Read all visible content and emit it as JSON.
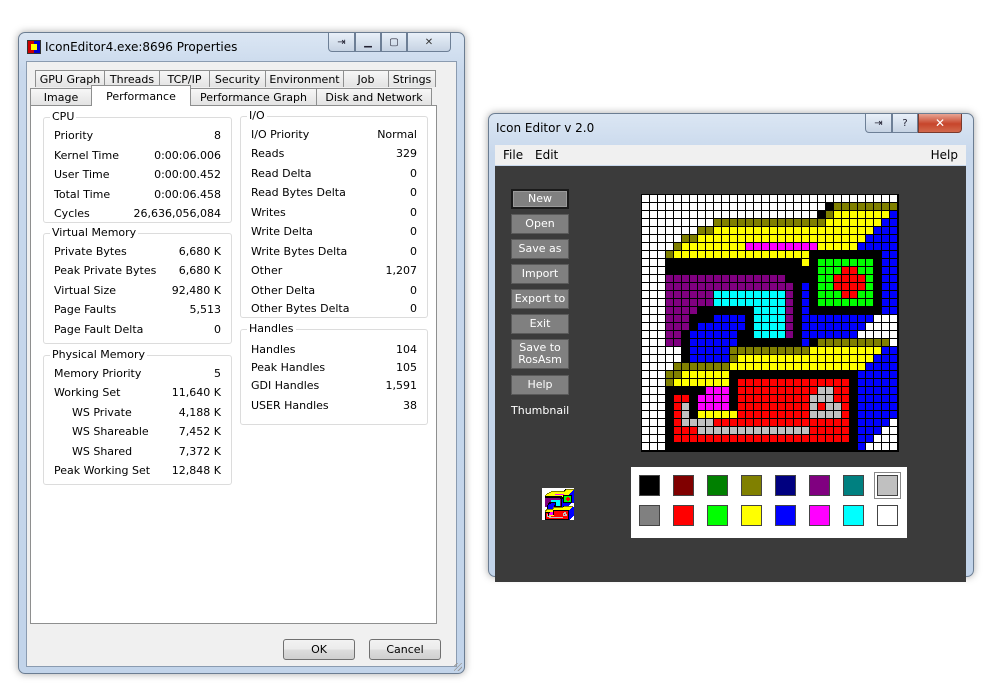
{
  "props_window": {
    "title": "IconEditor4.exe:8696 Properties",
    "tabs_row1": [
      "GPU Graph",
      "Threads",
      "TCP/IP",
      "Security",
      "Environment",
      "Job",
      "Strings"
    ],
    "tabs_row2": [
      "Image",
      "Performance",
      "Performance Graph",
      "Disk and Network"
    ],
    "selected_tab": "Performance",
    "cpu": {
      "label": "CPU",
      "rows": [
        {
          "k": "Priority",
          "v": "8"
        },
        {
          "k": "Kernel Time",
          "v": "0:00:06.006"
        },
        {
          "k": "User Time",
          "v": "0:00:00.452"
        },
        {
          "k": "Total Time",
          "v": "0:00:06.458"
        },
        {
          "k": "Cycles",
          "v": "26,636,056,084"
        }
      ]
    },
    "virtual_memory": {
      "label": "Virtual Memory",
      "rows": [
        {
          "k": "Private Bytes",
          "v": "6,680 K"
        },
        {
          "k": "Peak Private Bytes",
          "v": "6,680 K"
        },
        {
          "k": "Virtual Size",
          "v": "92,480 K"
        },
        {
          "k": "Page Faults",
          "v": "5,513"
        },
        {
          "k": "Page Fault Delta",
          "v": "0"
        }
      ]
    },
    "physical_memory": {
      "label": "Physical Memory",
      "rows": [
        {
          "k": "Memory Priority",
          "v": "5"
        },
        {
          "k": "Working Set",
          "v": "11,640 K"
        },
        {
          "k": "WS Private",
          "v": "4,188 K"
        },
        {
          "k": "WS Shareable",
          "v": "7,452 K"
        },
        {
          "k": "WS Shared",
          "v": "7,372 K"
        },
        {
          "k": "Peak Working Set",
          "v": "12,848 K"
        }
      ]
    },
    "io": {
      "label": "I/O",
      "rows": [
        {
          "k": "I/O Priority",
          "v": "Normal"
        },
        {
          "k": "Reads",
          "v": "329"
        },
        {
          "k": "Read Delta",
          "v": "0"
        },
        {
          "k": "Read Bytes Delta",
          "v": "0"
        },
        {
          "k": "Writes",
          "v": "0"
        },
        {
          "k": "Write Delta",
          "v": "0"
        },
        {
          "k": "Write Bytes Delta",
          "v": "0"
        },
        {
          "k": "Other",
          "v": "1,207"
        },
        {
          "k": "Other Delta",
          "v": "0"
        },
        {
          "k": "Other Bytes Delta",
          "v": "0"
        }
      ]
    },
    "handles": {
      "label": "Handles",
      "rows": [
        {
          "k": "Handles",
          "v": "104"
        },
        {
          "k": "Peak Handles",
          "v": "105"
        },
        {
          "k": "GDI Handles",
          "v": "1,591"
        },
        {
          "k": "USER Handles",
          "v": "38"
        }
      ]
    },
    "ok_label": "OK",
    "cancel_label": "Cancel"
  },
  "icon_editor": {
    "title": "Icon Editor v 2.0",
    "menu": {
      "file": "File",
      "edit": "Edit",
      "help": "Help"
    },
    "buttons": [
      "New",
      "Open",
      "Save as",
      "Import",
      "Export to",
      "Exit",
      "Save to RosAsm",
      "Help"
    ],
    "thumbnail_label": "Thumbnail",
    "palette_row1": [
      "#000000",
      "#800000",
      "#008000",
      "#808000",
      "#000080",
      "#800080",
      "#008080",
      "#c0c0c0"
    ],
    "palette_row2": [
      "#808080",
      "#ff0000",
      "#00ff00",
      "#ffff00",
      "#0000ff",
      "#ff00ff",
      "#00ffff",
      "#ffffff"
    ],
    "selected_color": "#c0c0c0",
    "pixel_map": [
      "WWWWWWWWWWWWWWWWWWWWWWWWWWWWWWWW",
      "WWWWWWWWWWWWWWWWWWWWWWWKOOOOOOOO",
      "WWWWWWWWWWWWWWWWWWWWWWKOYYYYYYYB",
      "WWWWWWWWWOOOOOOOOOOOOOOYYYYYYYBB",
      "WWWWWWWOOYYYYYYYYYYYYYYYYYYYYBBB",
      "WWWWWOOYYYYYYYYYYYYYYYYYYYYYBBBB",
      "WWWWOYYYYYYYYMMMMMMMMMYYYYYBBBBB",
      "WWWOYYYYYYYYYYYYYYYYYKKKKKKKKKBB",
      "WWWKKKKKKKKKKKKKKKKKYKGGGGGGGKBB",
      "WWWKKKKKKKKKKKKKKKKKKKGGGRRGGKBB",
      "WWWPPPPPPPPPPPPPPPKKKKGGRRRRGKBB",
      "WWWPPPPPPPPPPPPPPPPKBKGGRRRRGKBB",
      "WWWPPPPPPCCCCCCCCCPKBKGGGRRGGKBB",
      "WWWPPPPPPCCCCCCCCCPKBKGGGGGGGKBB",
      "WWWPPPPKKKKKKKCCCCPKBKKKKKKKKKBB",
      "WWWPPPKKKBBBBKCCCCPKBBBBBBBBBWWW",
      "WWWPPPKBBBBBBKCCCCPKBBBBBBBBWWWW",
      "WWWPPKBBBBBBKKCCCCPKBBBBBBBWWWWW",
      "WWWPPKBBBBBBKKKKKKKKBKOOOOOOOOOW",
      "WWWWWKBBBBBOOOOOOOOOOYYYYYYYYYBB",
      "WWWWWKBBBBBOYYYYYYYYYYYYYYYYYBBB",
      "WWWWOOOOOOOYYYYYYYYYYYYYYYYYBBBB",
      "WWWOOYYYYYYKKKKKKKKKKKKKKKKBBBBB",
      "WWWOYYYYYYYKRRRRRRRRRRRRRRKBBBBB",
      "WWWKKKKKMMMKRRRRRRRRRRLLRRKBBBBB",
      "WWWKRRKMMMMKRRRRRRRRRLLLRRKBBBBB",
      "WWWKRLKMMMMKRRRRRRRRRLRLLRKBBBBB",
      "WWWKRLKYYYYYRRRRRRRRRLLLLRKBBBBB",
      "WWWKRLLLLRRRRRRRRRRRRRRRRRKBBBBW",
      "WWWKRRRLLLLLLLLLLLLLLRRRRRKBBBWW",
      "WWWKRRRRRRRRRRRRRRRRRRRRRRKBBWWW",
      "WWWKKKKKKKKKKKKKKKKKKKKKKKKBWWWW"
    ]
  }
}
